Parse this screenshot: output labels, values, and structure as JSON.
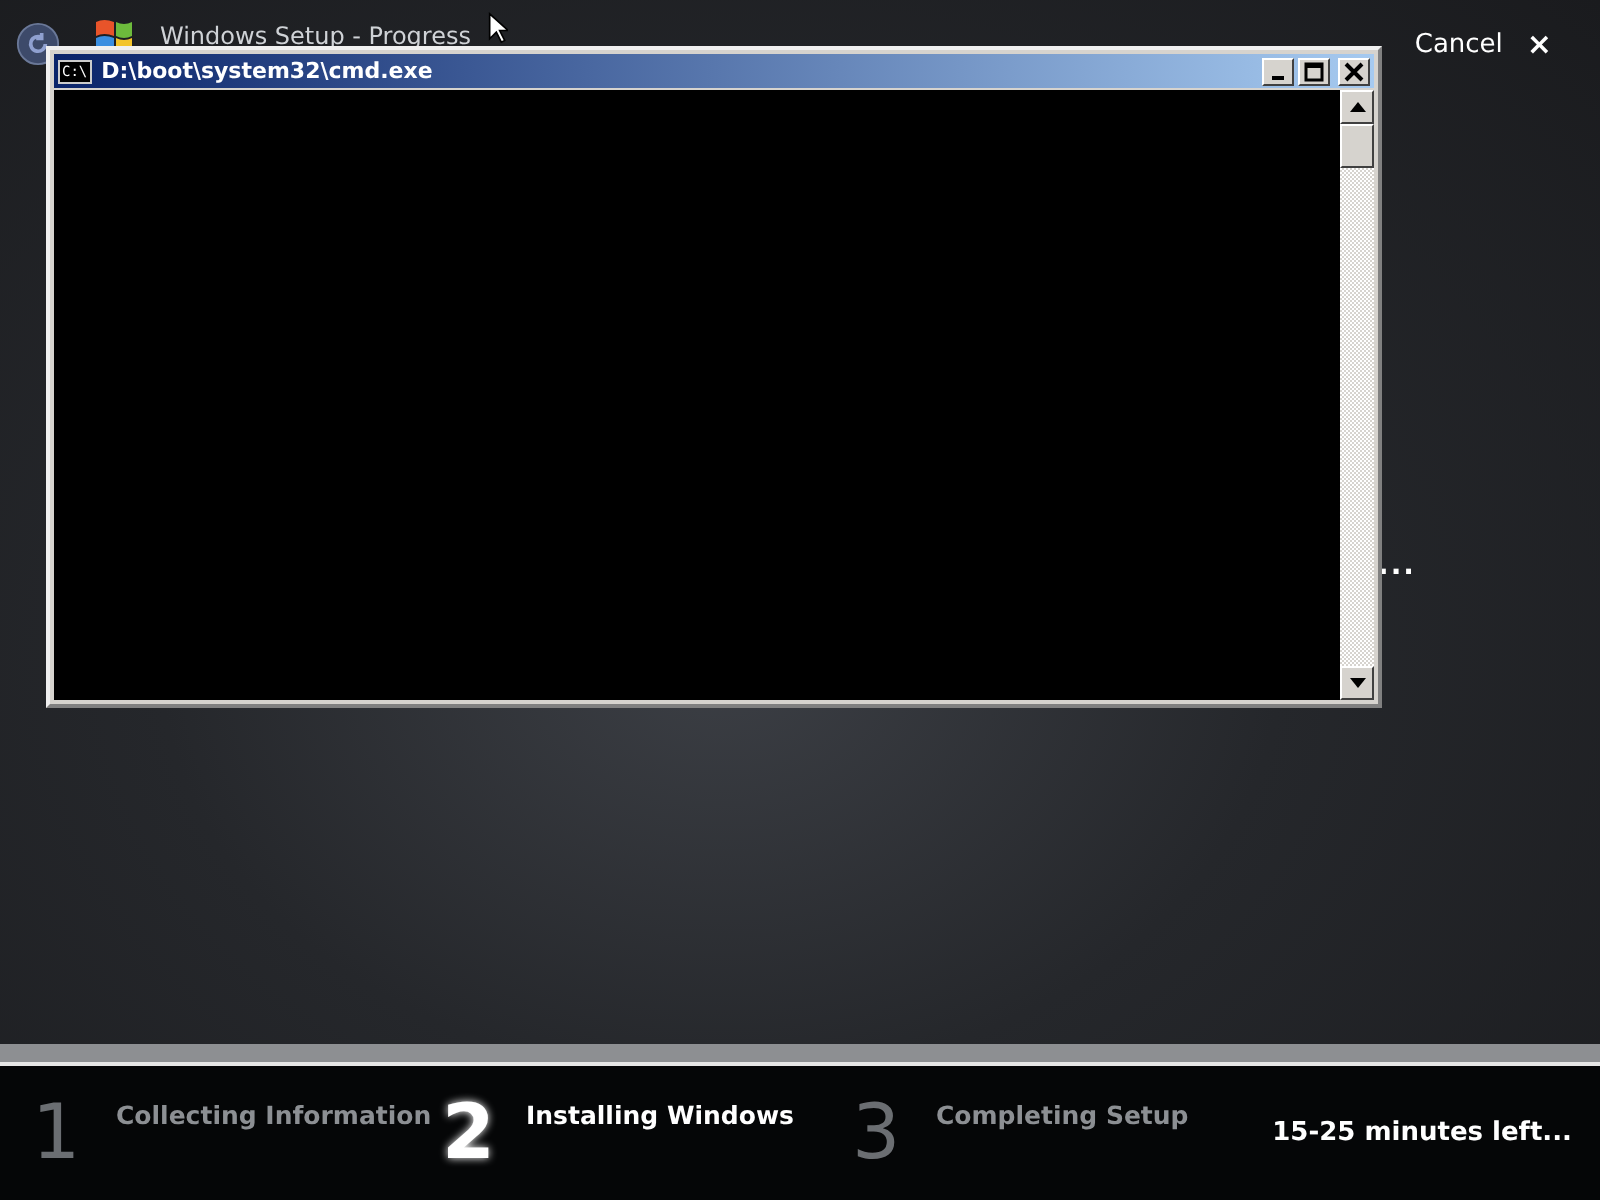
{
  "header": {
    "title": "Windows Setup - Progress",
    "cancel": "Cancel",
    "cancel_icon": "×"
  },
  "status_text": "...",
  "progress": {
    "level": 1
  },
  "console": {
    "title": "D:\\boot\\system32\\cmd.exe",
    "icon_text": "C:\\"
  },
  "steps": [
    {
      "number": "1",
      "label": "Collecting Information",
      "selected": false
    },
    {
      "number": "2",
      "label": "Installing Windows",
      "selected": true
    },
    {
      "number": "3",
      "label": "Completing Setup",
      "selected": false
    }
  ],
  "time_left": "15-25 minutes left..."
}
